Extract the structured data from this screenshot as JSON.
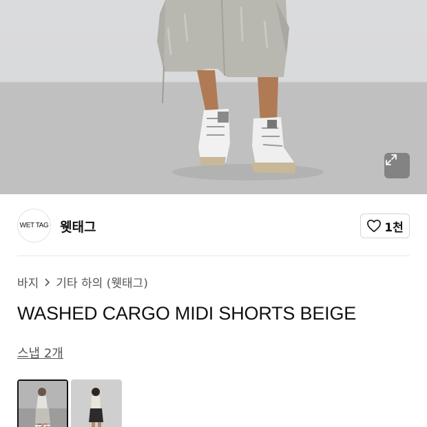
{
  "hero": {
    "expand_icon": "expand-icon"
  },
  "brand": {
    "logo_text": "WET TAG",
    "name": "웻태그",
    "like_icon": "heart-outline-icon",
    "like_count": "1천"
  },
  "breadcrumb": {
    "items": [
      "바지",
      "기타 하의 (웻태그)"
    ],
    "separator_icon": "chevron-right-icon"
  },
  "product": {
    "title": "WASHED CARGO MIDI SHORTS BEIGE"
  },
  "snaps": {
    "link_label": "스냅 2개",
    "thumbs": [
      {
        "label": "포토"
      },
      {
        "label": ""
      }
    ]
  },
  "colors": {
    "text": "#111111",
    "muted": "#555555",
    "border": "#d5d5d5"
  }
}
